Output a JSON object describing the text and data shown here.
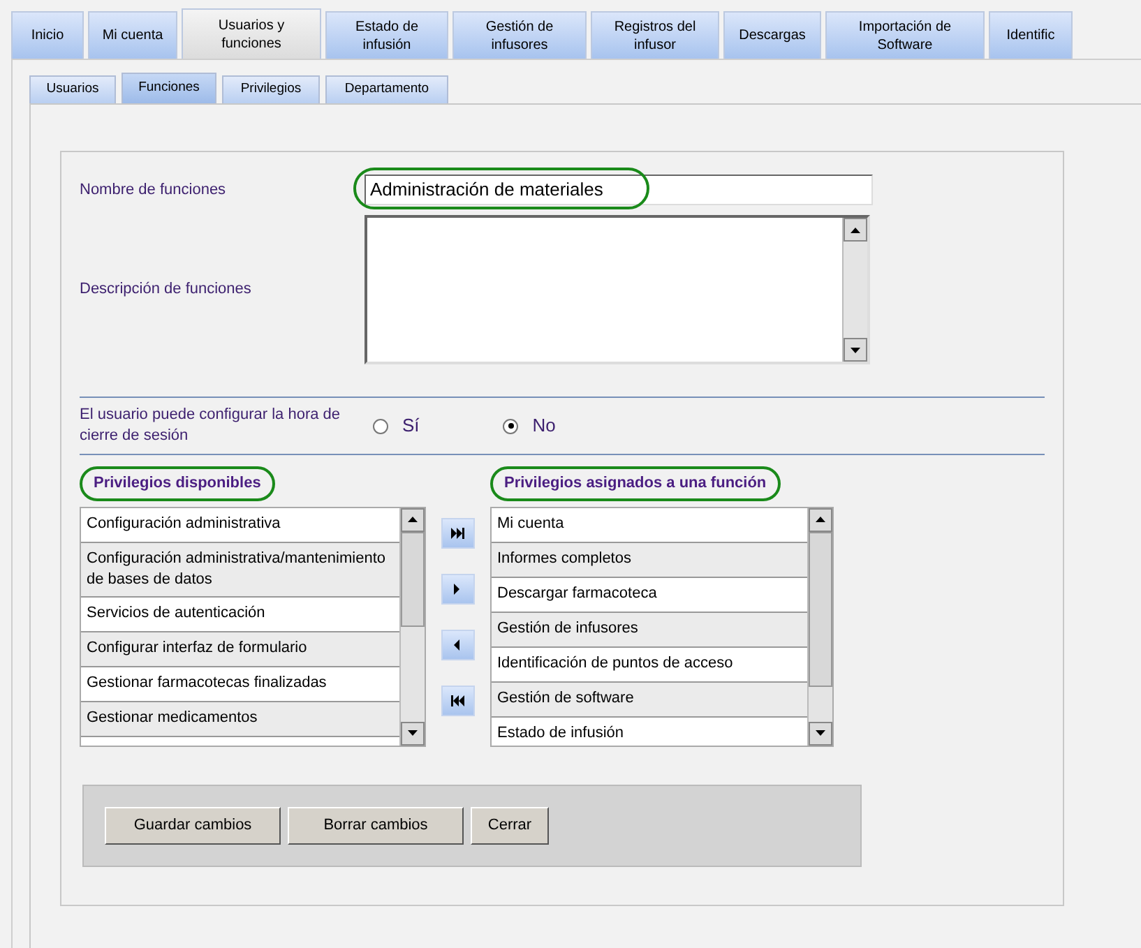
{
  "main_tabs": [
    {
      "label": "Inicio",
      "selected": false
    },
    {
      "label": "Mi cuenta",
      "selected": false
    },
    {
      "label": "Usuarios y funciones",
      "selected": true
    },
    {
      "label": "Estado de infusión",
      "selected": false
    },
    {
      "label": "Gestión de infusores",
      "selected": false
    },
    {
      "label": "Registros del infusor",
      "selected": false
    },
    {
      "label": "Descargas",
      "selected": false
    },
    {
      "label": "Importación de Software",
      "selected": false
    },
    {
      "label": "Identific",
      "selected": false
    }
  ],
  "sub_tabs": [
    {
      "label": "Usuarios",
      "selected": false
    },
    {
      "label": "Funciones",
      "selected": true
    },
    {
      "label": "Privilegios",
      "selected": false
    },
    {
      "label": "Departamento",
      "selected": false
    }
  ],
  "name_field": {
    "label": "Nombre de funciones",
    "value": "Administración de materiales",
    "highlighted": true
  },
  "description_field": {
    "label": "Descripción de funciones"
  },
  "logout_option": {
    "label": "El usuario puede configurar la hora de cierre de sesión",
    "options": [
      {
        "label": "Sí",
        "selected": false
      },
      {
        "label": "No",
        "selected": true
      }
    ]
  },
  "available": {
    "title": "Privilegios disponibles",
    "highlighted": true,
    "items": [
      "Configuración administrativa",
      "Configuración administrativa/mantenimiento de bases de datos",
      "Servicios de autenticación",
      "Configurar interfaz de formulario",
      "Gestionar farmacotecas finalizadas",
      "Gestionar medicamentos"
    ]
  },
  "assigned": {
    "title": "Privilegios asignados a una función",
    "highlighted": true,
    "items": [
      "Mi cuenta",
      "Informes completos",
      "Descargar farmacoteca",
      "Gestión de infusores",
      "Identificación de puntos de acceso",
      "Gestión de software",
      "Estado de infusión"
    ]
  },
  "transfer_buttons": [
    {
      "kind": "add-all"
    },
    {
      "kind": "add"
    },
    {
      "kind": "remove"
    },
    {
      "kind": "remove-all"
    }
  ],
  "buttons": [
    "Guardar cambios",
    "Borrar cambios",
    "Cerrar"
  ]
}
